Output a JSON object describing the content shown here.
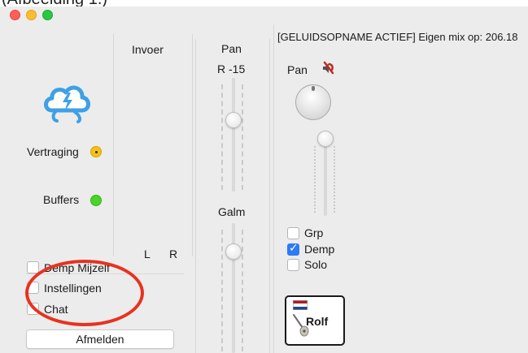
{
  "caption": "(Afbeelding 1.)",
  "window": {
    "status_banner": "[GELUIDSOPNAME ACTIEF] Eigen mix op: 206.18"
  },
  "input_section": {
    "title": "Invoer",
    "channels": [
      "L",
      "R"
    ]
  },
  "status": {
    "delay_label": "Vertraging",
    "delay_color": "#f6c112",
    "buffers_label": "Buffers",
    "buffers_color": "#49d32b"
  },
  "options": [
    {
      "label": "Demp Mijzelf",
      "checked": false
    },
    {
      "label": "Instellingen",
      "checked": false
    },
    {
      "label": "Chat",
      "checked": false
    }
  ],
  "logout_button": "Afmelden",
  "own_mix": {
    "pan_title": "Pan",
    "pan_value": "R -15",
    "reverb_title": "Galm"
  },
  "channel_strip": {
    "pan_label": "Pan",
    "checkboxes": [
      {
        "label": "Grp",
        "checked": false
      },
      {
        "label": "Demp",
        "checked": true
      },
      {
        "label": "Solo",
        "checked": false
      }
    ],
    "player_name": "Rolf",
    "flag_colors": [
      "#ae1c28",
      "#ffffff",
      "#21468b"
    ]
  },
  "colors": {
    "highlight_ellipse": "#e8321f",
    "logo_blue": "#3ea0e6",
    "checkbox_blue": "#2f7af5"
  }
}
